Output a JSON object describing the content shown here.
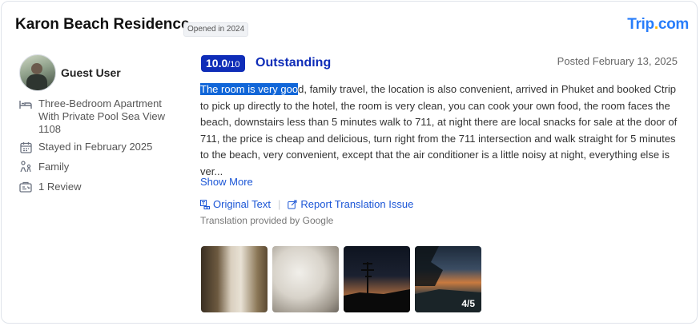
{
  "header": {
    "hotel_name": "Karon Beach Residence",
    "opened_badge": "Opened in 2024",
    "brand_name": "Trip",
    "brand_dot": ".",
    "brand_tld": "com"
  },
  "reviewer": {
    "name": "Guest User",
    "room": "Three-Bedroom Apartment With Private Pool Sea View 1108",
    "stay": "Stayed in February 2025",
    "traveler_type": "Family",
    "review_count": "1 Review"
  },
  "review": {
    "score": "10.0",
    "score_out_of": "/10",
    "rating_label": "Outstanding",
    "posted": "Posted February 13, 2025",
    "text_highlighted": "The room is very goo",
    "text_rest": "d, family travel, the location is also convenient, arrived in Phuket and booked Ctrip to pick up directly to the hotel, the room is very clean, you can cook your own food, the room faces the beach, downstairs less than 5 minutes walk to 711, at night there are local snacks for sale at the door of 711, the price is cheap and delicious, turn right from the 711 intersection and walk straight for 5 minutes to the beach, very convenient, except that the air conditioner is a little noisy at night, everything else is ver...",
    "show_more": "Show More",
    "original_text": "Original Text",
    "report_issue": "Report Translation Issue",
    "translation_provider": "Translation provided by Google",
    "photo_count": "4/5"
  },
  "colors": {
    "accent": "#0f2db8",
    "link": "#1a55d6",
    "brand": "#287dfa",
    "brand_dot": "#ffb400"
  },
  "icons": {
    "room": "bed-icon",
    "stay": "calendar-icon",
    "traveler": "family-icon",
    "reviews": "review-icon",
    "original_text": "translate-icon",
    "report": "report-icon"
  }
}
